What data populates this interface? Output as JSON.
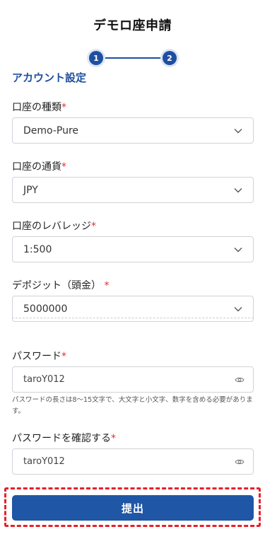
{
  "page": {
    "title": "デモロ座申請"
  },
  "stepper": {
    "step1": "1",
    "step2": "2"
  },
  "section": {
    "title": "アカウント設定"
  },
  "fields": {
    "account_type": {
      "label": "口座の種類",
      "required": "*",
      "value": "Demo-Pure"
    },
    "currency": {
      "label": "口座の通貨",
      "required": "*",
      "value": "JPY"
    },
    "leverage": {
      "label": "口座のレバレッジ",
      "required": "*",
      "value": "1:500"
    },
    "deposit": {
      "label": "デポジット（頭金）",
      "required": "*",
      "value": "5000000"
    },
    "password": {
      "label": "パスワード",
      "required": "*",
      "value": "taroY012",
      "hint": "パスワードの長さは8〜15文字で、大文字と小文字、数字を含める必要があります。"
    },
    "password_confirm": {
      "label": "パスワードを確認する",
      "required": "*",
      "value": "taroY012"
    }
  },
  "actions": {
    "submit_label": "提出"
  },
  "colors": {
    "accent": "#1f4fa0",
    "required": "#e03030",
    "highlight_border": "#e8202a"
  },
  "icons": {
    "select_chevron": "chevron-down-icon",
    "password_visibility": "eye-icon"
  }
}
